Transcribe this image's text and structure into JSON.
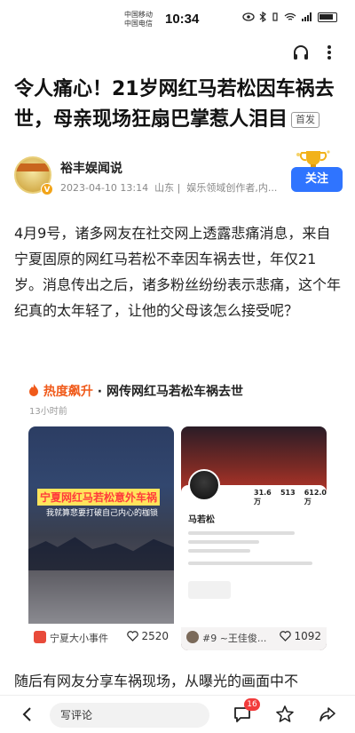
{
  "status_bar": {
    "carrier_1": "中国移动",
    "carrier_2": "中国电信",
    "time": "10:34"
  },
  "article": {
    "title": "令人痛心！21岁网红马若松因车祸去世，母亲现场狂扇巴掌惹人泪目",
    "first_badge": "首发",
    "author_name": "裕丰娱闻说",
    "date": "2023-04-10 13:14",
    "location": "山东",
    "author_tag": "娱乐领域创作者,内...",
    "follow_label": "关注",
    "paragraph_1": "4月9号，诸多网友在社交网上透露悲痛消息，来自宁夏固原的网红马若松不幸因车祸去世，年仅21岁。消息传出之后，诸多粉丝纷纷表示悲痛，这个年纪真的太年轻了，让他的父母该怎么接受呢？",
    "paragraph_2": "随后有网友分享车祸现场，从曝光的画面中不"
  },
  "trending": {
    "hot_label": "热度飙升",
    "separator": "·",
    "topic": "网传网红马若松车祸去世",
    "time_ago": "13小时前",
    "cards": [
      {
        "overlay_title": "宁夏网红马若松意外车祸",
        "overlay_sub": "我就算悲要打破自己内心的枷锁",
        "source": "宁夏大小事件",
        "likes": "2520"
      },
      {
        "profile_name": "马若松",
        "stats": [
          "31.6万",
          "513",
          "612.0万"
        ],
        "source": "#9 ~王佳俊...",
        "likes": "1092"
      }
    ]
  },
  "bottom_bar": {
    "comment_placeholder": "写评论",
    "comment_count": "16"
  }
}
